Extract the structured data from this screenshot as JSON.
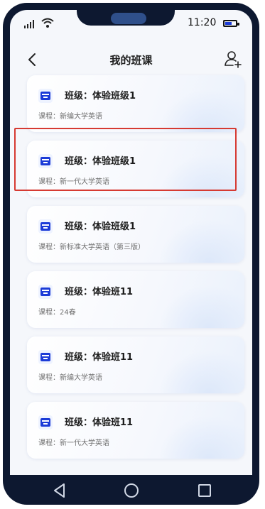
{
  "status": {
    "time": "11:20"
  },
  "header": {
    "title": "我的班课"
  },
  "classes": [
    {
      "class_label": "班级：体验班级1",
      "course_label": "课程：新编大学英语"
    },
    {
      "class_label": "班级：体验班级1",
      "course_label": "课程：新一代大学英语"
    },
    {
      "class_label": "班级：体验班级1",
      "course_label": "课程：新标准大学英语（第三版）"
    },
    {
      "class_label": "班级：体验班11",
      "course_label": "课程：24春"
    },
    {
      "class_label": "班级：体验班11",
      "course_label": "课程：新编大学英语"
    },
    {
      "class_label": "班级：体验班11",
      "course_label": "课程：新一代大学英语"
    }
  ],
  "colors": {
    "accent": "#1b3bd7",
    "highlight": "#d63a32",
    "frame": "#0d1830"
  },
  "icons": {
    "back": "chevron-left-icon",
    "add_member": "add-user-icon",
    "class": "classroom-icon",
    "nav_back": "triangle-back-icon",
    "nav_home": "circle-home-icon",
    "nav_recents": "square-recents-icon"
  }
}
